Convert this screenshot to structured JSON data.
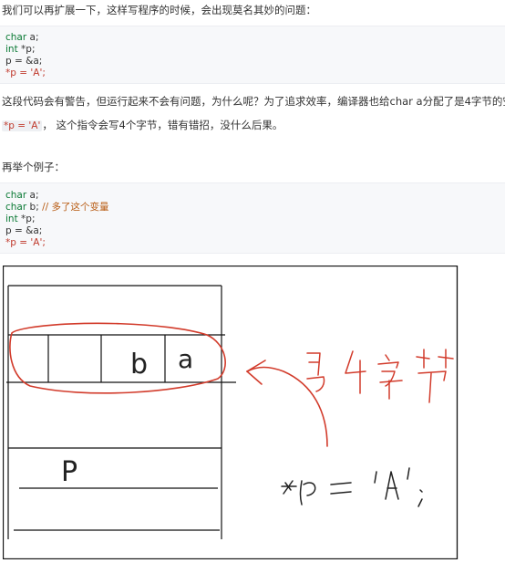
{
  "intro_text": "我们可以再扩展一下，这样写程序的时候，会出现莫名其妙的问题：",
  "code1": {
    "lines": [
      {
        "type": "char",
        "rest": " a;"
      },
      {
        "type": "int",
        "rest": " *p;"
      },
      {
        "type": "",
        "rest": "p = &a;"
      },
      {
        "type": "",
        "rest": "*p = 'A';"
      }
    ]
  },
  "para2": "这段代码会有警告，但运行起来不会有问题，为什么呢？为了追求效率，编译器也给char a分配了是4字节的空间",
  "para3": {
    "code": "*p = 'A'",
    "text": "，  这个指令会写4个字节，错有错招，没什么后果。"
  },
  "para4": "再举个例子：",
  "code2": {
    "lines": [
      {
        "type": "char",
        "rest": " a;",
        "comment": ""
      },
      {
        "type": "char",
        "rest": " b;",
        "comment": "  // 多了这个变量"
      },
      {
        "type": "int",
        "rest": " *p;",
        "comment": ""
      },
      {
        "type": "",
        "rest": "p = &a;",
        "comment": ""
      },
      {
        "type": "",
        "rest": "*p = 'A';",
        "comment": ""
      }
    ]
  },
  "sketch": {
    "cell_labels": [
      "b",
      "a"
    ],
    "pointer_label": "P",
    "annotation_arrow": "写4字节",
    "annotation_bottom": "*p = 'A';"
  },
  "colors": {
    "keyword": "#0b7a35",
    "operator": "#c0392b",
    "comment": "#b85b12",
    "ink_red": "#d23b2b",
    "ink_black": "#222222"
  }
}
